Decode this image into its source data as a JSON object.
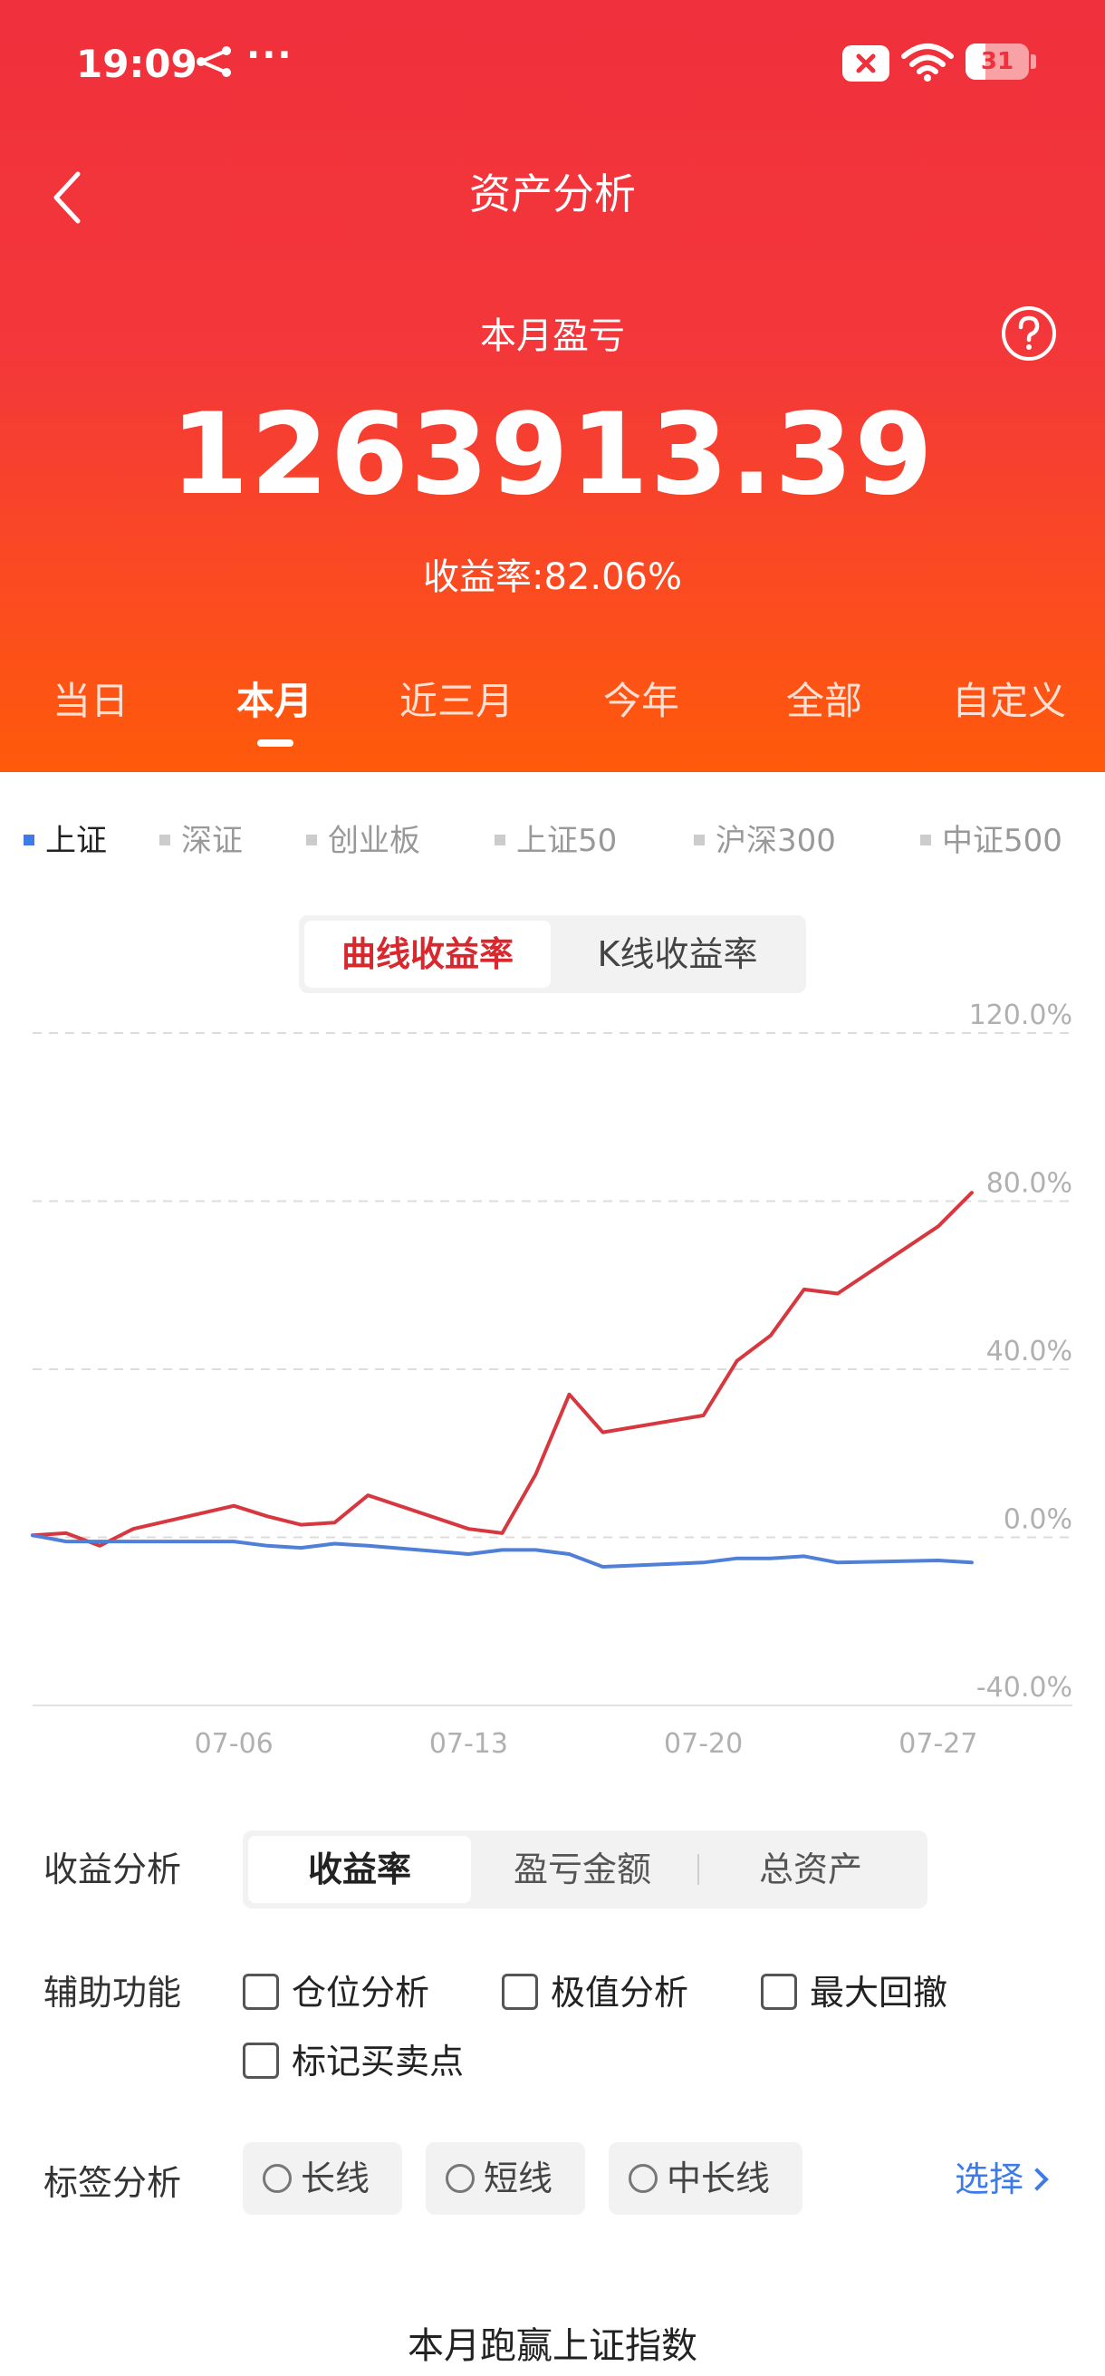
{
  "status_bar": {
    "time": "19:09",
    "dots": "···",
    "battery_level": "31",
    "battery_fraction": 0.31,
    "icons": [
      "share-icon",
      "close-x-icon",
      "wifi-icon",
      "battery-icon"
    ]
  },
  "header": {
    "title": "资产分析",
    "pl_label": "本月盈亏",
    "pl_value": "1263913.39",
    "rate_label": "收益率:",
    "rate_value": "82.06%"
  },
  "period_tabs": [
    {
      "label": "当日",
      "active": false
    },
    {
      "label": "本月",
      "active": true
    },
    {
      "label": "近三月",
      "active": false
    },
    {
      "label": "今年",
      "active": false
    },
    {
      "label": "全部",
      "active": false
    },
    {
      "label": "自定义",
      "active": false
    }
  ],
  "index_tabs": [
    {
      "label": "上证",
      "active": true
    },
    {
      "label": "深证",
      "active": false
    },
    {
      "label": "创业板",
      "active": false
    },
    {
      "label": "上证50",
      "active": false
    },
    {
      "label": "沪深300",
      "active": false
    },
    {
      "label": "中证500",
      "active": false
    }
  ],
  "chart_toggle": {
    "active": "曲线收益率",
    "inactive": "K线收益率"
  },
  "colors": {
    "header_top": "#f0303c",
    "header_bottom": "#ff5a0a",
    "portfolio_line": "#d7373f",
    "index_line": "#4f7fd6",
    "accent_blue": "#3c7be8",
    "active_red": "#d8282e"
  },
  "chart_data": {
    "type": "line",
    "x_tick_labels": [
      "07-06",
      "07-13",
      "07-20",
      "07-27"
    ],
    "y_tick_labels": [
      "120.0%",
      "80.0%",
      "40.0%",
      "0.0%",
      "-40.0%"
    ],
    "ylim": [
      -40,
      120
    ],
    "y_ticks": [
      120,
      80,
      40,
      0,
      -40
    ],
    "grid": true,
    "x_tick_index": [
      6,
      13,
      20,
      27
    ],
    "x": [
      0,
      1,
      2,
      3,
      6,
      7,
      8,
      9,
      10,
      13,
      14,
      15,
      16,
      17,
      20,
      21,
      22,
      23,
      24,
      27,
      28
    ],
    "series": [
      {
        "values": [
          0.5,
          1,
          -2,
          2,
          7.5,
          5,
          3,
          3.5,
          10,
          2,
          1,
          15,
          34,
          25,
          29,
          42,
          48,
          59,
          58,
          74,
          82
        ]
      },
      {
        "values": [
          0.5,
          -1,
          -1,
          -1,
          -1,
          -2,
          -2.5,
          -1.5,
          -2,
          -4,
          -3,
          -3,
          -4,
          -7,
          -6,
          -5,
          -5,
          -4.5,
          -6,
          -5.5,
          -6
        ]
      }
    ]
  },
  "analysis": {
    "label": "收益分析",
    "options": [
      {
        "label": "收益率",
        "active": true
      },
      {
        "label": "盈亏金额",
        "active": false
      },
      {
        "label": "总资产",
        "active": false
      }
    ]
  },
  "aux": {
    "label": "辅助功能",
    "items": [
      "仓位分析",
      "极值分析",
      "最大回撤",
      "标记买卖点"
    ]
  },
  "tags": {
    "label": "标签分析",
    "items": [
      "长线",
      "短线",
      "中长线"
    ],
    "select_label": "选择"
  },
  "bottom_title": "本月跑赢上证指数"
}
